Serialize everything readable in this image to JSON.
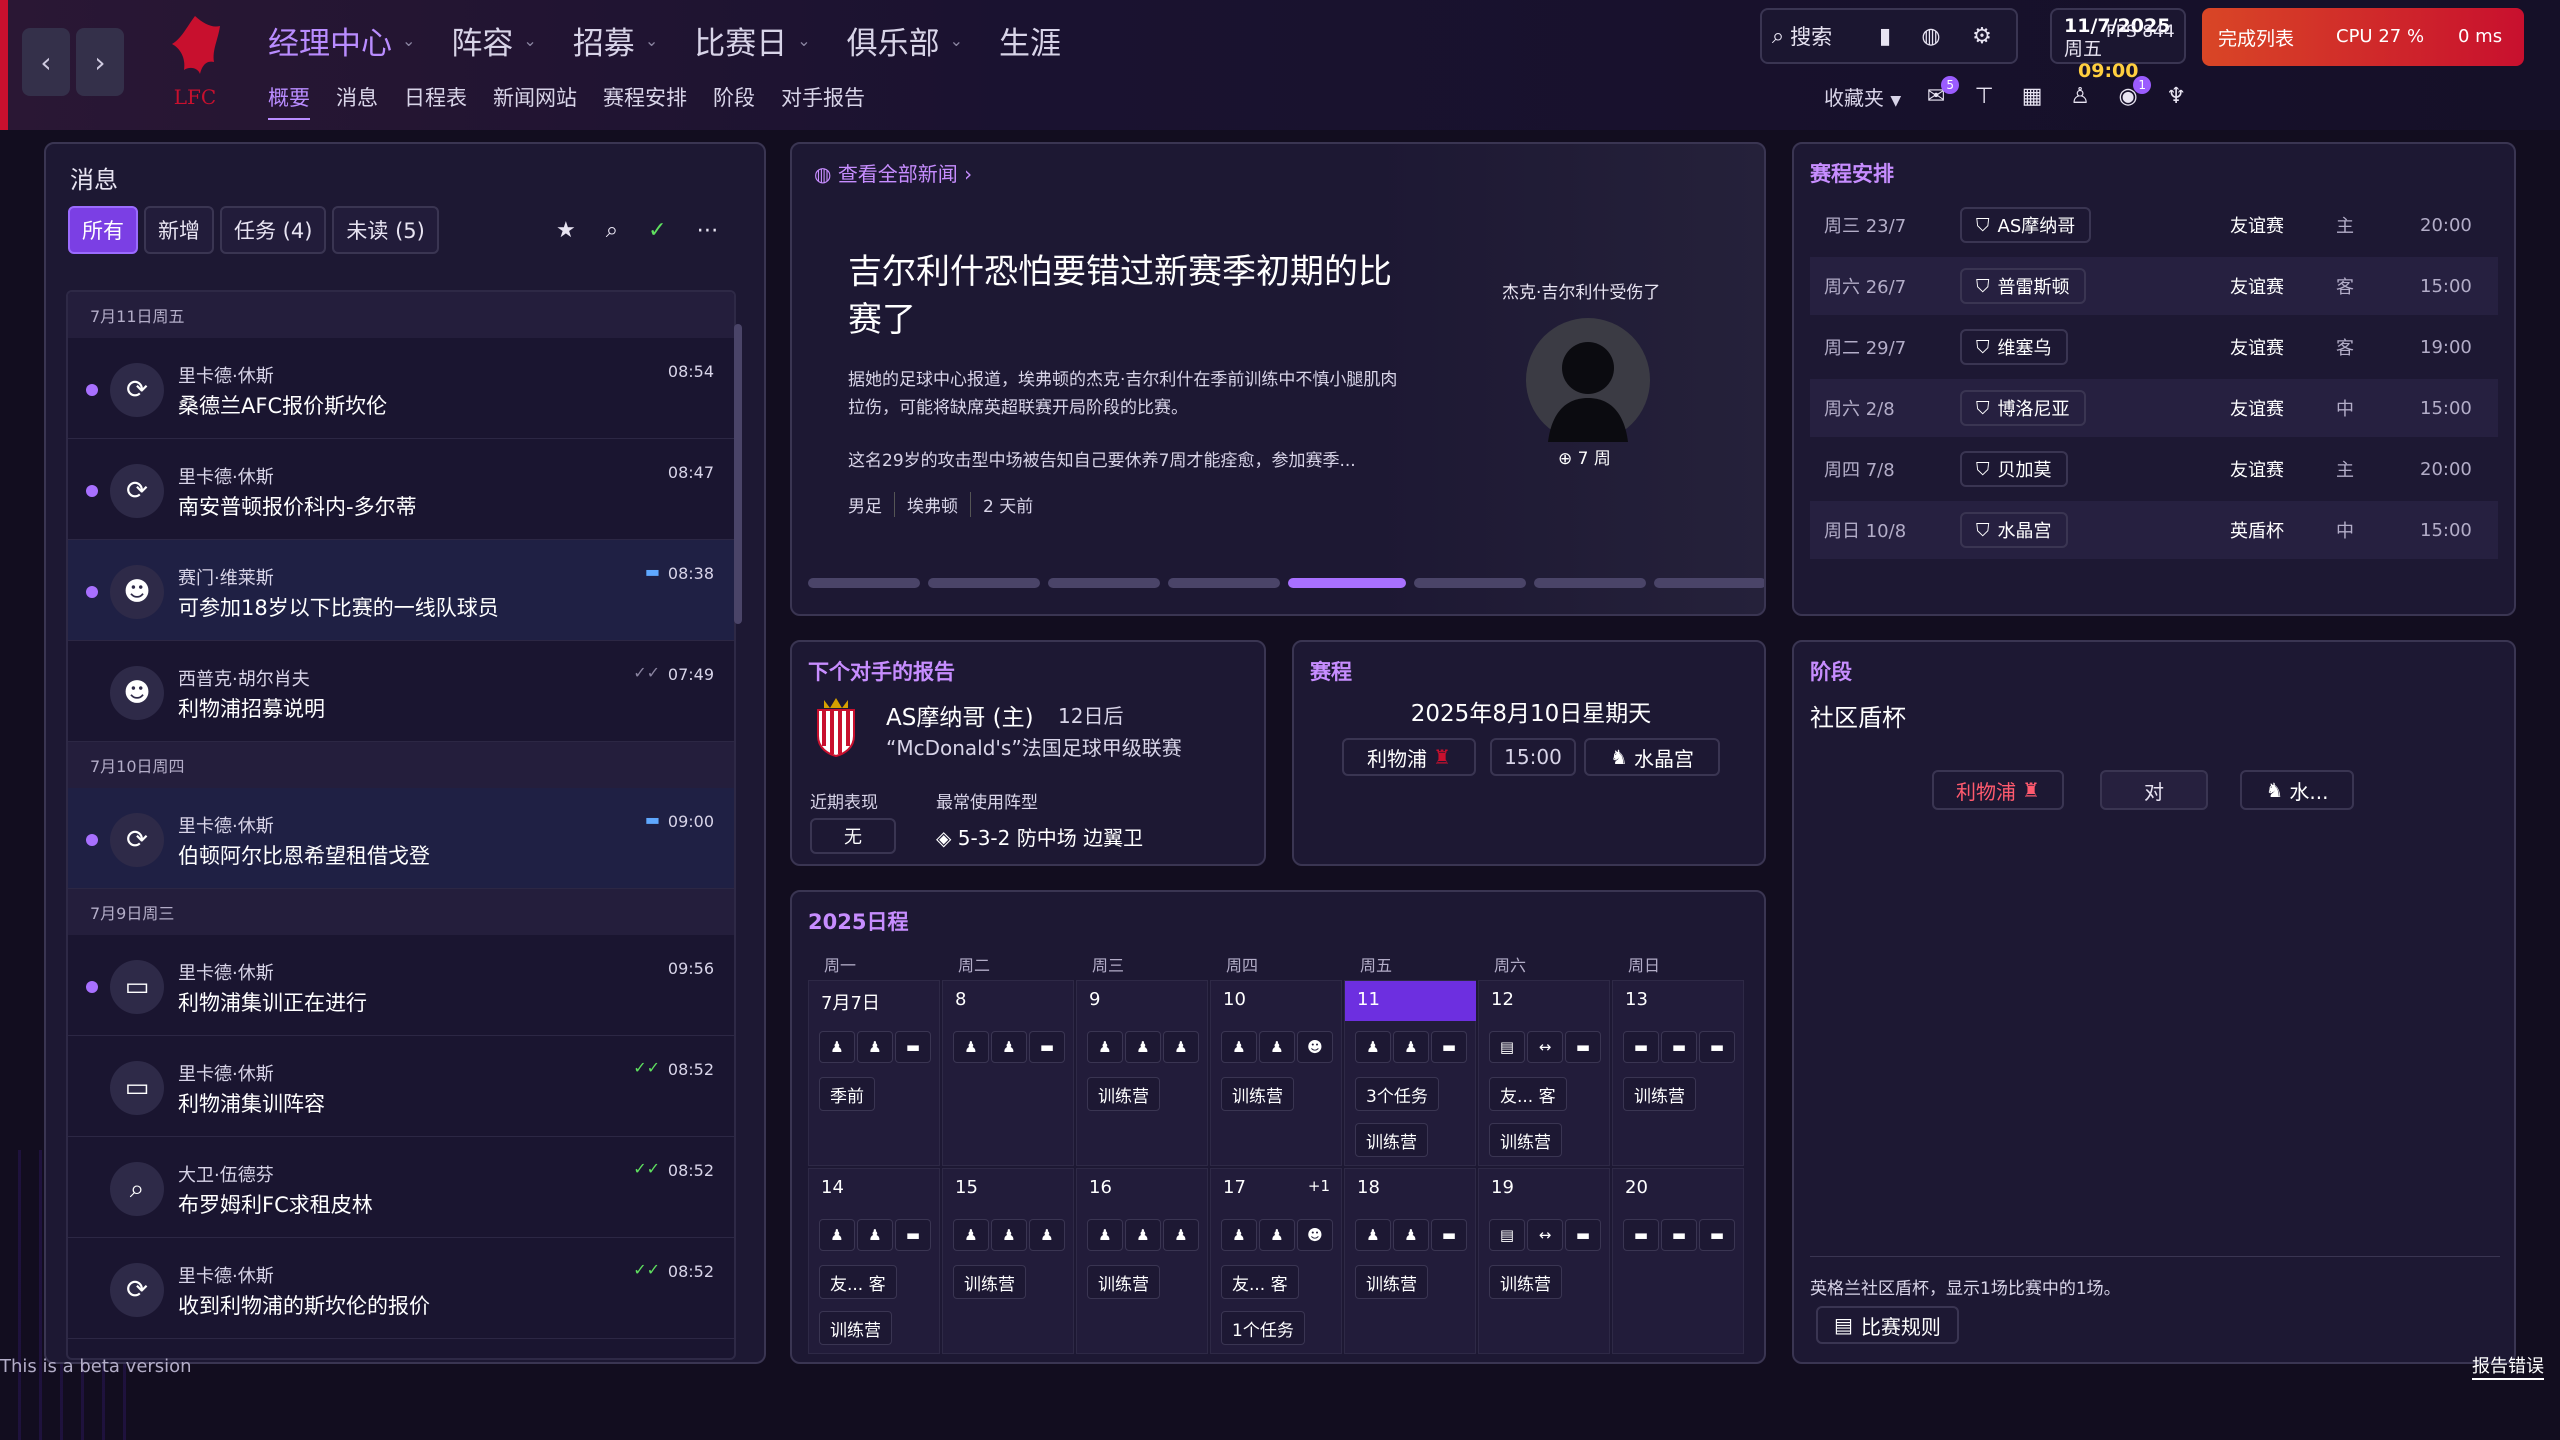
{
  "topbar": {
    "main_nav": [
      "经理中心",
      "阵容",
      "招募",
      "比赛日",
      "俱乐部",
      "生涯"
    ],
    "sub_nav": [
      "概要",
      "消息",
      "日程表",
      "新闻网站",
      "赛程安排",
      "阶段",
      "对手报告"
    ],
    "club_logo_text": "LFC",
    "search_label": "搜索",
    "date": "11/7/2025",
    "weekday": "周五",
    "time": "09:00",
    "fps": "FPS 844",
    "continue_label": "完成列表",
    "cpu": "CPU 27 %",
    "latency": "0 ms",
    "favorites_label": "收藏夹",
    "badge_messages": "5",
    "badge_alert": "1"
  },
  "messages": {
    "title": "消息",
    "tabs": [
      "所有",
      "新增",
      "任务 (4)",
      "未读 (5)"
    ],
    "groups": [
      {
        "day": "7月11日周五",
        "items": [
          {
            "from": "里卡德·休斯",
            "subject": "桑德兰AFC报价斯坎伦",
            "time": "08:54",
            "unread": true,
            "icon": "transfer-icon",
            "highlight": false,
            "flag": ""
          },
          {
            "from": "里卡德·休斯",
            "subject": "南安普顿报价科内-多尔蒂",
            "time": "08:47",
            "unread": true,
            "icon": "transfer-icon",
            "highlight": false,
            "flag": ""
          },
          {
            "from": "赛门·维莱斯",
            "subject": "可参加18岁以下比赛的一线队球员",
            "time": "08:38",
            "unread": true,
            "icon": "team-icon",
            "highlight": true,
            "flag": "chat"
          },
          {
            "from": "西普克·胡尔肖夫",
            "subject": "利物浦招募说明",
            "time": "07:49",
            "unread": false,
            "icon": "team-icon",
            "highlight": false,
            "flag": "read"
          }
        ]
      },
      {
        "day": "7月10日周四",
        "items": [
          {
            "from": "里卡德·休斯",
            "subject": "伯顿阿尔比恩希望租借戈登",
            "time": "09:00",
            "unread": true,
            "icon": "transfer-icon",
            "highlight": true,
            "flag": "chat"
          }
        ]
      },
      {
        "day": "7月9日周三",
        "items": [
          {
            "from": "里卡德·休斯",
            "subject": "利物浦集训正在进行",
            "time": "09:56",
            "unread": true,
            "icon": "briefcase-icon",
            "highlight": false,
            "flag": ""
          },
          {
            "from": "里卡德·休斯",
            "subject": "利物浦集训阵容",
            "time": "08:52",
            "unread": false,
            "icon": "briefcase-icon",
            "highlight": false,
            "flag": "done"
          },
          {
            "from": "大卫·伍德芬",
            "subject": "布罗姆利FC求租皮林",
            "time": "08:52",
            "unread": false,
            "icon": "scout-icon",
            "highlight": false,
            "flag": "done"
          },
          {
            "from": "里卡德·休斯",
            "subject": "收到利物浦的斯坎伦的报价",
            "time": "08:52",
            "unread": false,
            "icon": "transfer-icon",
            "highlight": false,
            "flag": "done"
          }
        ]
      }
    ]
  },
  "news": {
    "header": "查看全部新闻",
    "title": "吉尔利什恐怕要错过新赛季初期的比赛了",
    "body": "据她的足球中心报道，埃弗顿的杰克·吉尔利什在季前训练中不慎小腿肌肉拉伤，可能将缺席英超联赛开局阶段的比赛。",
    "body2": "这名29岁的攻击型中场被告知自己要休养7周才能痊愈，参加赛季...",
    "tags": [
      "男足",
      "埃弗顿",
      "2 天前"
    ],
    "injury_label": "杰克·吉尔利什受伤了",
    "injury_weeks": "7 周",
    "pages": 8,
    "active_page": 5
  },
  "fixtures": {
    "title": "赛程安排",
    "rows": [
      {
        "date": "周三 23/7",
        "team": "AS摩纳哥",
        "comp": "友谊赛",
        "venue": "主",
        "time": "20:00"
      },
      {
        "date": "周六 26/7",
        "team": "普雷斯顿",
        "comp": "友谊赛",
        "venue": "客",
        "time": "15:00"
      },
      {
        "date": "周二 29/7",
        "team": "维塞乌",
        "comp": "友谊赛",
        "venue": "客",
        "time": "19:00"
      },
      {
        "date": "周六 2/8",
        "team": "博洛尼亚",
        "comp": "友谊赛",
        "venue": "中",
        "time": "15:00"
      },
      {
        "date": "周四 7/8",
        "team": "贝加莫",
        "comp": "友谊赛",
        "venue": "主",
        "time": "20:00"
      },
      {
        "date": "周日 10/8",
        "team": "水晶宫",
        "comp": "英盾杯",
        "venue": "中",
        "time": "15:00"
      }
    ]
  },
  "opponent": {
    "title": "下个对手的报告",
    "name": "AS摩纳哥 (主)",
    "days": "12日后",
    "league": "“McDonald's”法国足球甲级联赛",
    "form_label": "近期表现",
    "form_value": "无",
    "formation_label": "最常使用阵型",
    "formation_value": "5-3-2 防中场 边翼卫"
  },
  "match": {
    "title": "赛程",
    "date": "2025年8月10日星期天",
    "home": "利物浦",
    "time": "15:00",
    "away": "水晶宫"
  },
  "stage": {
    "title": "阶段",
    "name": "社区盾杯",
    "home": "利物浦",
    "vs": "对",
    "away": "水...",
    "desc": "英格兰社区盾杯，显示1场比赛中的1场。",
    "rules": "比赛规则"
  },
  "calendar": {
    "title": "2025日程",
    "weekdays": [
      "周一",
      "周二",
      "周三",
      "周四",
      "周五",
      "周六",
      "周日"
    ],
    "weeks": [
      [
        {
          "day": "7月7日",
          "icons": [
            "train",
            "train",
            "rest"
          ],
          "items": [
            "季前"
          ],
          "today": false
        },
        {
          "day": "8",
          "icons": [
            "train",
            "train",
            "rest"
          ],
          "items": [],
          "today": false
        },
        {
          "day": "9",
          "icons": [
            "train",
            "train",
            "train"
          ],
          "items": [
            "训练营"
          ],
          "today": false
        },
        {
          "day": "10",
          "icons": [
            "train",
            "train",
            "team"
          ],
          "items": [
            "训练营"
          ],
          "today": false
        },
        {
          "day": "11",
          "icons": [
            "train",
            "train",
            "rest"
          ],
          "items": [
            "3个任务",
            "训练营"
          ],
          "today": true
        },
        {
          "day": "12",
          "icons": [
            "doc",
            "move",
            "rest"
          ],
          "items": [
            "友... 客",
            "训练营"
          ],
          "today": false
        },
        {
          "day": "13",
          "icons": [
            "rest",
            "rest",
            "rest"
          ],
          "items": [
            "训练营"
          ],
          "today": false
        }
      ],
      [
        {
          "day": "14",
          "icons": [
            "train",
            "train",
            "rest"
          ],
          "items": [
            "友... 客",
            "训练营"
          ],
          "today": false
        },
        {
          "day": "15",
          "icons": [
            "train",
            "train",
            "train"
          ],
          "items": [
            "训练营"
          ],
          "today": false
        },
        {
          "day": "16",
          "icons": [
            "train",
            "train",
            "train"
          ],
          "items": [
            "训练营"
          ],
          "today": false
        },
        {
          "day": "17",
          "extra": "+1",
          "icons": [
            "train",
            "train",
            "team"
          ],
          "items": [
            "友... 客",
            "1个任务"
          ],
          "today": false
        },
        {
          "day": "18",
          "icons": [
            "train",
            "train",
            "rest"
          ],
          "items": [
            "训练营"
          ],
          "today": false
        },
        {
          "day": "19",
          "icons": [
            "doc",
            "move",
            "rest"
          ],
          "items": [
            "训练营"
          ],
          "today": false
        },
        {
          "day": "20",
          "icons": [
            "rest",
            "rest",
            "rest"
          ],
          "items": [],
          "today": false
        }
      ]
    ]
  },
  "footer": {
    "beta": "This is a beta version",
    "report": "报告错误"
  },
  "colors": {
    "accent": "#a870ff",
    "liverpool_red": "#c8102e",
    "background": "#120d1f",
    "panel": "#1d1833"
  }
}
